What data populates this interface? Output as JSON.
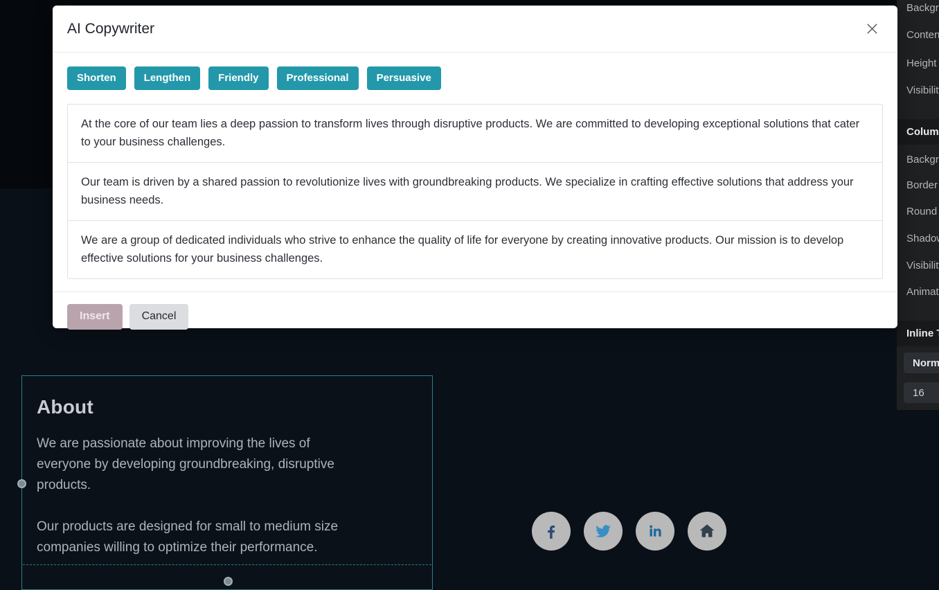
{
  "modal": {
    "title": "AI Copywriter",
    "close_icon": "close-icon",
    "tone_buttons": [
      {
        "label": "Shorten"
      },
      {
        "label": "Lengthen"
      },
      {
        "label": "Friendly"
      },
      {
        "label": "Professional"
      },
      {
        "label": "Persuasive"
      }
    ],
    "suggestions": [
      "At the core of our team lies a deep passion to transform lives through disruptive products. We are committed to developing exceptional solutions that cater to your business challenges.",
      "Our team is driven by a shared passion to revolutionize lives with groundbreaking products. We specialize in crafting effective solutions that address your business needs.",
      "We are a group of dedicated individuals who strive to enhance the quality of life for everyone by creating innovative products. Our mission is to develop effective solutions for your business challenges."
    ],
    "insert_label": "Insert",
    "cancel_label": "Cancel",
    "accent_color": "#2398ab",
    "insert_color": "#b9a4ae",
    "cancel_color": "#dcdde0"
  },
  "canvas": {
    "section_title": "About",
    "section_paragraph_1": "We are passionate about improving the lives of everyone by developing groundbreaking, disruptive products.",
    "section_paragraph_2": "Our products are designed for small to medium size companies willing to optimize their performance.",
    "selection_color": "#2a7d8c",
    "social_links": [
      {
        "name": "facebook-icon"
      },
      {
        "name": "twitter-icon"
      },
      {
        "name": "linkedin-icon"
      },
      {
        "name": "home-icon"
      }
    ]
  },
  "sidebar": {
    "items": [
      {
        "label": "Background"
      },
      {
        "label": "Content"
      },
      {
        "label": "Height"
      },
      {
        "label": "Visibility"
      }
    ],
    "column_heading": "Column",
    "column_items": [
      {
        "label": "Background"
      },
      {
        "label": "Border"
      },
      {
        "label": "Round Corners"
      },
      {
        "label": "Shadow"
      },
      {
        "label": "Visibility"
      },
      {
        "label": "Animation"
      }
    ],
    "inline_heading": "Inline Text",
    "font_weight_value": "Normal",
    "font_size_value": "16"
  }
}
